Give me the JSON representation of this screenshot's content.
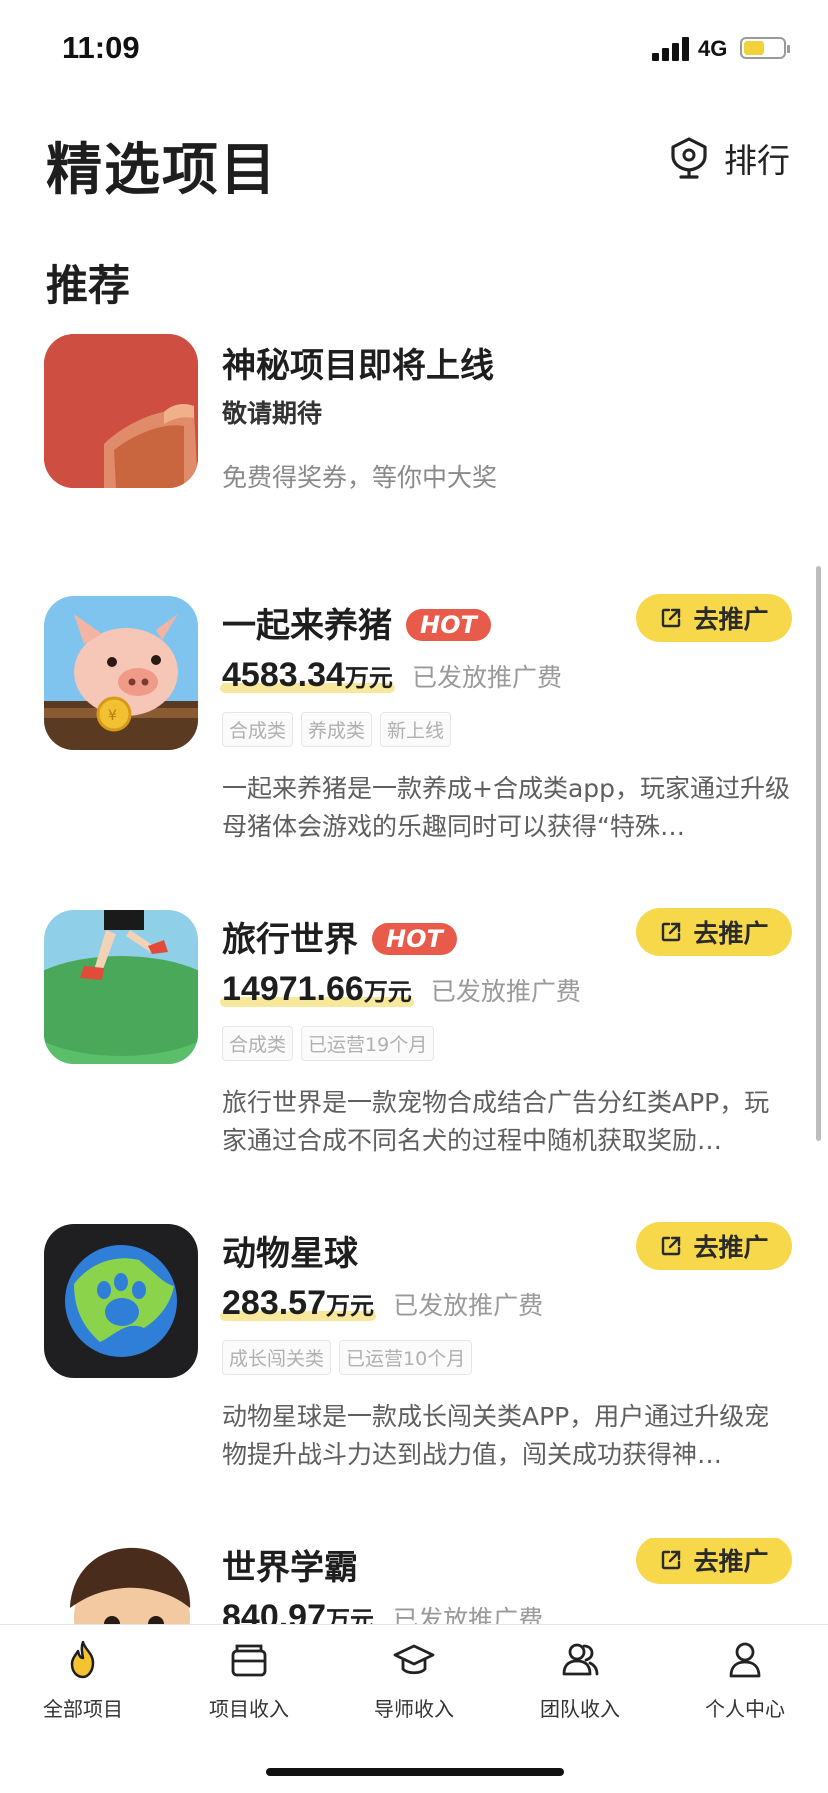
{
  "status_bar": {
    "time": "11:09",
    "network": "4G"
  },
  "header": {
    "title": "精选项目",
    "rank_label": "排行"
  },
  "section": {
    "title": "推荐"
  },
  "featured": {
    "name": "神秘项目即将上线",
    "subtitle": "敬请期待",
    "note": "免费得奖券，等你中大奖"
  },
  "promote_label": "去推广",
  "hot_label": "HOT",
  "projects": [
    {
      "name": "一起来养猪",
      "hot": true,
      "amount": "4583.34",
      "unit": "万元",
      "amount_label": "已发放推广费",
      "tags": [
        "合成类",
        "养成类",
        "新上线"
      ],
      "desc": "一起来养猪是一款养成+合成类app，玩家通过升级母猪体会游戏的乐趣同时可以获得“特殊…"
    },
    {
      "name": "旅行世界",
      "hot": true,
      "amount": "14971.66",
      "unit": "万元",
      "amount_label": "已发放推广费",
      "tags": [
        "合成类",
        "已运营19个月"
      ],
      "desc": "旅行世界是一款宠物合成结合广告分红类APP，玩家通过合成不同名犬的过程中随机获取奖励…"
    },
    {
      "name": "动物星球",
      "hot": false,
      "amount": "283.57",
      "unit": "万元",
      "amount_label": "已发放推广费",
      "tags": [
        "成长闯关类",
        "已运营10个月"
      ],
      "desc": "动物星球是一款成长闯关类APP，用户通过升级宠物提升战斗力达到战力值，闯关成功获得神…"
    },
    {
      "name": "世界学霸",
      "hot": false,
      "amount": "840.97",
      "unit": "万元",
      "amount_label": "已发放推广费"
    }
  ],
  "tabs": [
    {
      "label": "全部项目",
      "icon": "flame-icon",
      "active": true
    },
    {
      "label": "项目收入",
      "icon": "wallet-icon"
    },
    {
      "label": "导师收入",
      "icon": "graduation-cap-icon"
    },
    {
      "label": "团队收入",
      "icon": "team-icon"
    },
    {
      "label": "个人中心",
      "icon": "person-icon"
    }
  ],
  "colors": {
    "accent_yellow": "#f6d84a",
    "hot_red": "#e85a4a",
    "text_dark": "#1e1e1e",
    "text_muted": "#9a9a9a"
  }
}
